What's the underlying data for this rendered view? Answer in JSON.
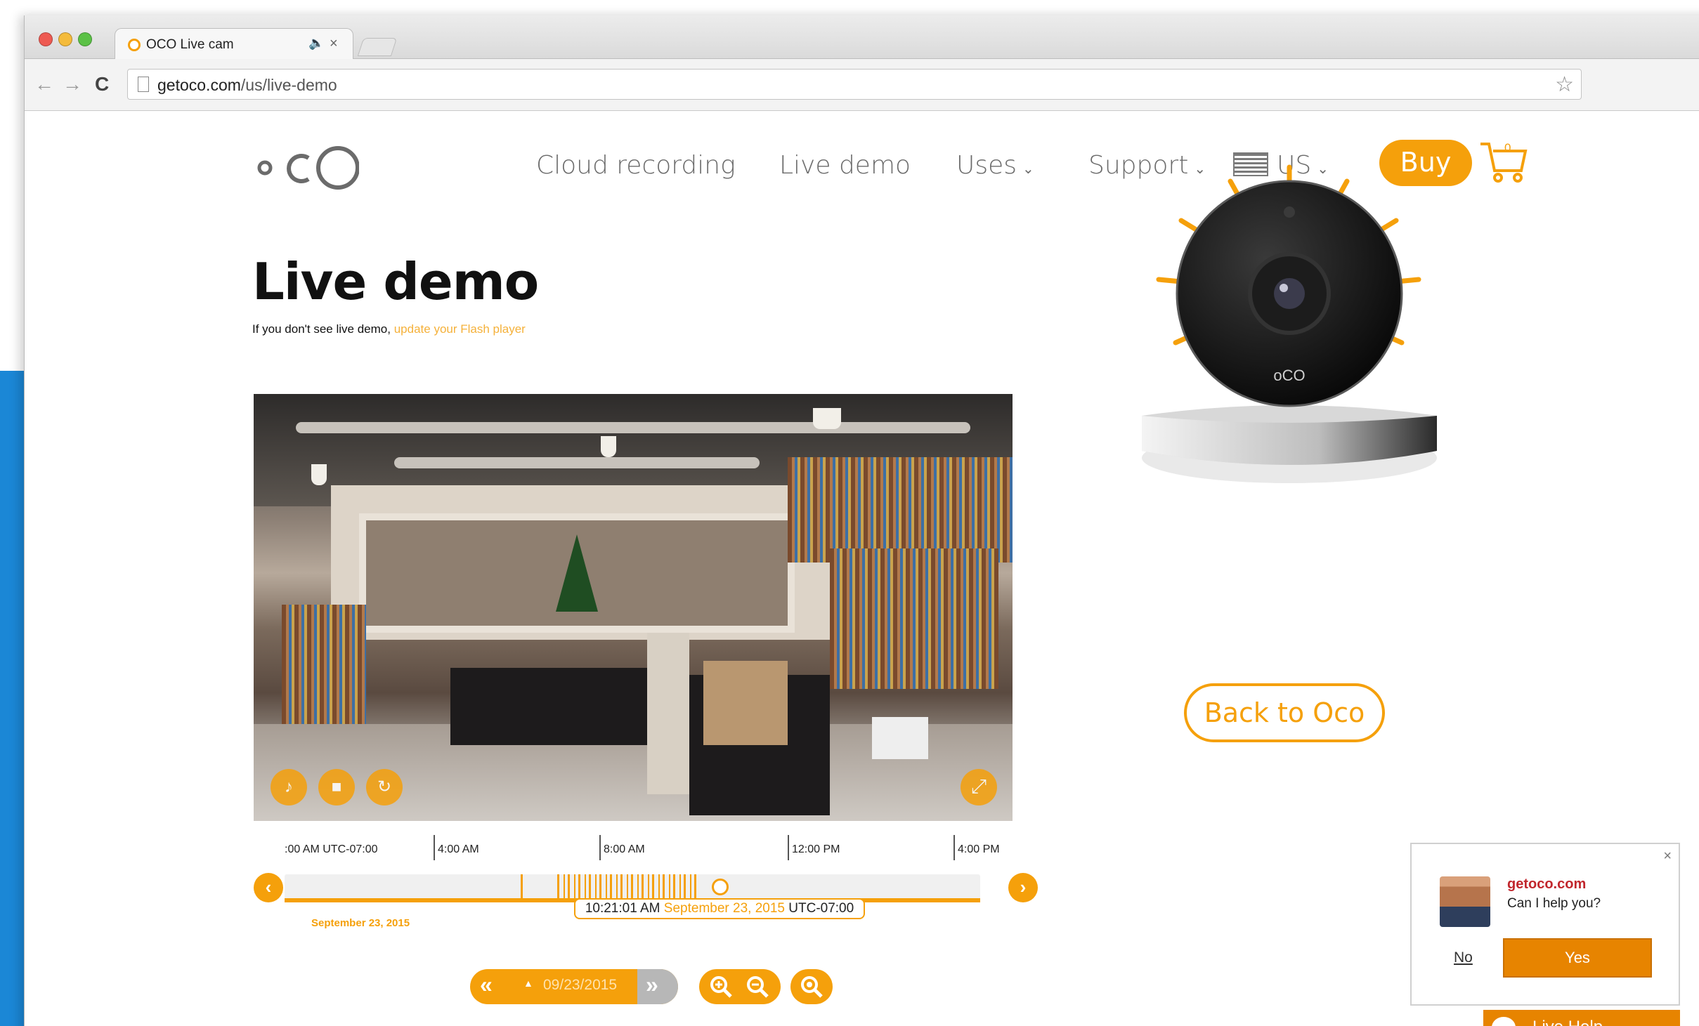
{
  "browser": {
    "tab_title": "OCO Live cam",
    "tab_audio_icon": "speaker-icon",
    "tab_close": "×",
    "url_host": "getoco.com",
    "url_path": "/us/live-demo"
  },
  "nav": {
    "logo": "oCO",
    "cloud_recording": "Cloud recording",
    "live_demo": "Live demo",
    "uses": "Uses",
    "support": "Support",
    "region": "US",
    "buy": "Buy",
    "cart_count": "0"
  },
  "main": {
    "title": "Live demo",
    "subtitle": "If you don't see live demo,",
    "flash_link": "update your Flash player"
  },
  "timeline": {
    "ticks": [
      ":00 AM UTC-07:00",
      "4:00 AM",
      "8:00 AM",
      "12:00 PM",
      "4:00 PM"
    ],
    "current_time": "10:21:01 AM",
    "current_date": "September 23, 2015",
    "current_tz": "UTC-07:00",
    "start_date": "September 23, 2015",
    "selected_date": "09/23/2015"
  },
  "camera_logo": "oCO",
  "back_button": "Back to Oco",
  "chat": {
    "site": "getoco.com",
    "question": "Can I help you?",
    "no": "No",
    "yes": "Yes",
    "close": "×",
    "live_help": "Live Help"
  },
  "colors": {
    "accent": "#f5a00b",
    "chat_orange": "#e78400",
    "chat_brand_red": "#c1272d"
  }
}
